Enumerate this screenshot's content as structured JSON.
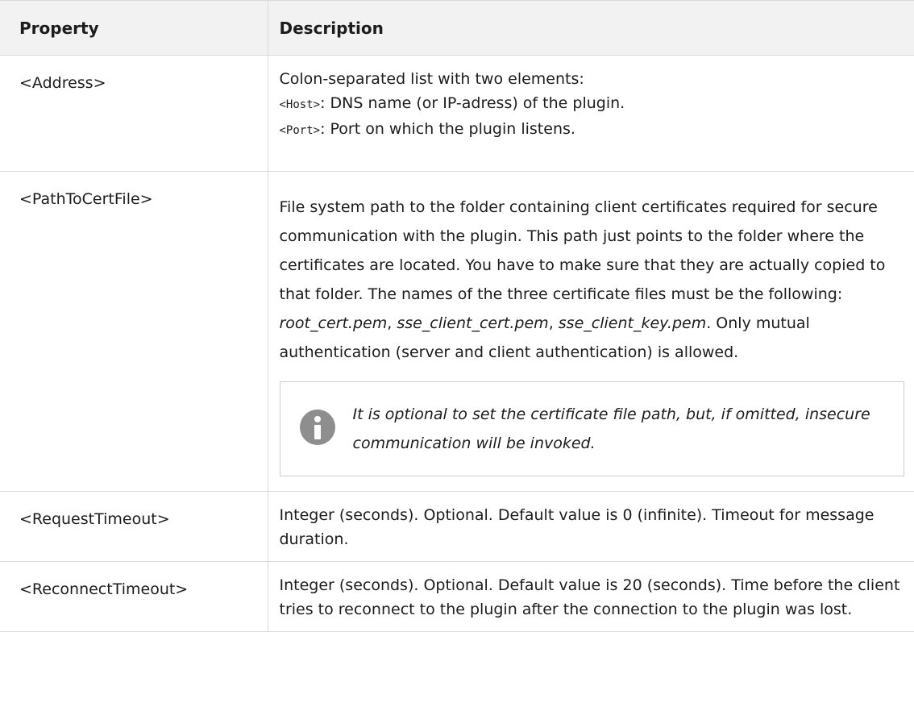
{
  "table": {
    "headers": {
      "property": "Property",
      "description": "Description"
    },
    "rows": [
      {
        "property": "<Address>",
        "desc_intro": "Colon-separated list with two elements:",
        "host_code": "<Host>",
        "host_text": ": DNS name (or IP-adress) of the plugin.",
        "port_code": "<Port>",
        "port_text": ": Port on which the plugin listens."
      },
      {
        "property": "<PathToCertFile>",
        "desc_before": "File system path to the folder containing client certificates required for secure communication with the plugin. This path just points to the folder where the certificates are located. You have to make sure that they are actually copied to that folder. The names of the three certificate files must be the following: ",
        "file1": "root_cert.pem",
        "sep1": ", ",
        "file2": "sse_client_cert.pem",
        "sep2": ", ",
        "file3": "sse_client_key.pem",
        "desc_after": ". Only mutual authentication (server and client authentication) is allowed.",
        "note": "It is optional to set the certificate file path, but, if omitted, insecure communication will be invoked.",
        "note_icon": "info-icon"
      },
      {
        "property": "<RequestTimeout>",
        "description": "Integer (seconds). Optional. Default value is 0 (infinite). Timeout for message duration."
      },
      {
        "property": "<ReconnectTimeout>",
        "description": "Integer (seconds). Optional. Default value is 20 (seconds). Time before the client tries to reconnect to the plugin after the connection to the plugin was lost."
      }
    ]
  }
}
